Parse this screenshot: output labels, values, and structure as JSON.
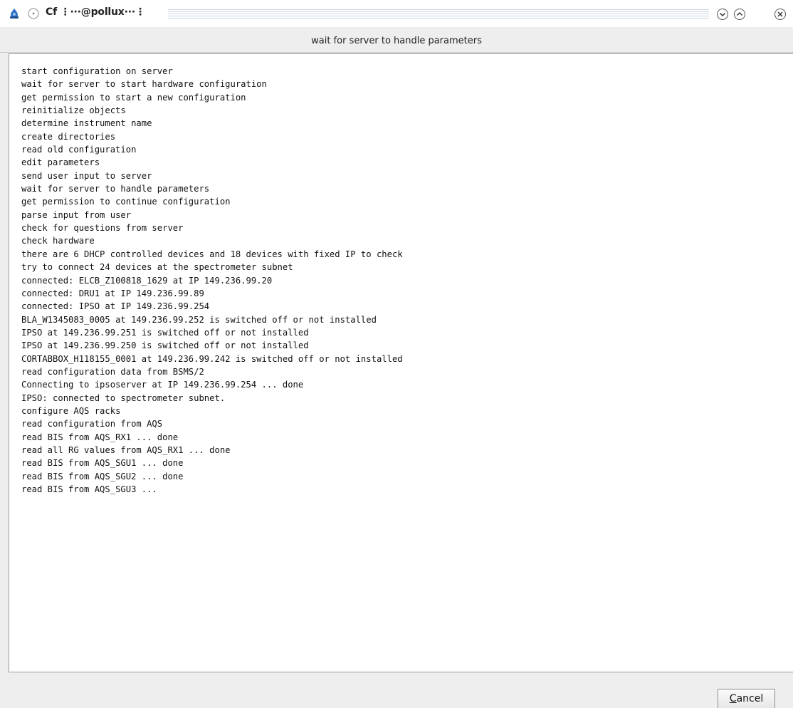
{
  "window": {
    "title": "Cf ⋮···@pollux···⋮",
    "icons": {
      "app": "app-icon",
      "menu": "window-menu-icon",
      "minimize": "minimize-icon",
      "maximize": "maximize-icon",
      "close": "close-icon"
    }
  },
  "header": {
    "status": "wait for server to handle parameters"
  },
  "log": {
    "lines": [
      "start configuration on server",
      "wait for server to start hardware configuration",
      "get permission to start a new configuration",
      "reinitialize objects",
      "determine instrument name",
      "create directories",
      "read old configuration",
      "edit parameters",
      "send user input to server",
      "wait for server to handle parameters",
      "get permission to continue configuration",
      "parse input from user",
      "check for questions from server",
      "check hardware",
      "there are 6 DHCP controlled devices and 18 devices with fixed IP to check",
      "try to connect 24 devices at the spectrometer subnet",
      "connected: ELCB_Z100818_1629 at IP 149.236.99.20",
      "connected: DRU1 at IP 149.236.99.89",
      "connected: IPSO at IP 149.236.99.254",
      "BLA_W1345083_0005 at 149.236.99.252 is switched off or not installed",
      "IPSO at 149.236.99.251 is switched off or not installed",
      "IPSO at 149.236.99.250 is switched off or not installed",
      "CORTABBOX_H118155_0001 at 149.236.99.242 is switched off or not installed",
      "read configuration data from BSMS/2",
      "Connecting to ipsoserver at IP 149.236.99.254 ... done",
      "IPSO: connected to spectrometer subnet.",
      "configure AQS racks",
      "read configuration from AQS",
      "read BIS from AQS_RX1 ... done",
      "read all RG values from AQS_RX1 ... done",
      "read BIS from AQS_SGU1 ... done",
      "read BIS from AQS_SGU2 ... done",
      "read BIS from AQS_SGU3 ..."
    ]
  },
  "footer": {
    "cancel_mnemonic": "C",
    "cancel_rest": "ancel"
  },
  "colors": {
    "app_icon_blue": "#2f6fc4",
    "title_stripe": "#c9d3dd",
    "panel_bg": "#eeeeee",
    "log_bg": "#ffffff"
  }
}
